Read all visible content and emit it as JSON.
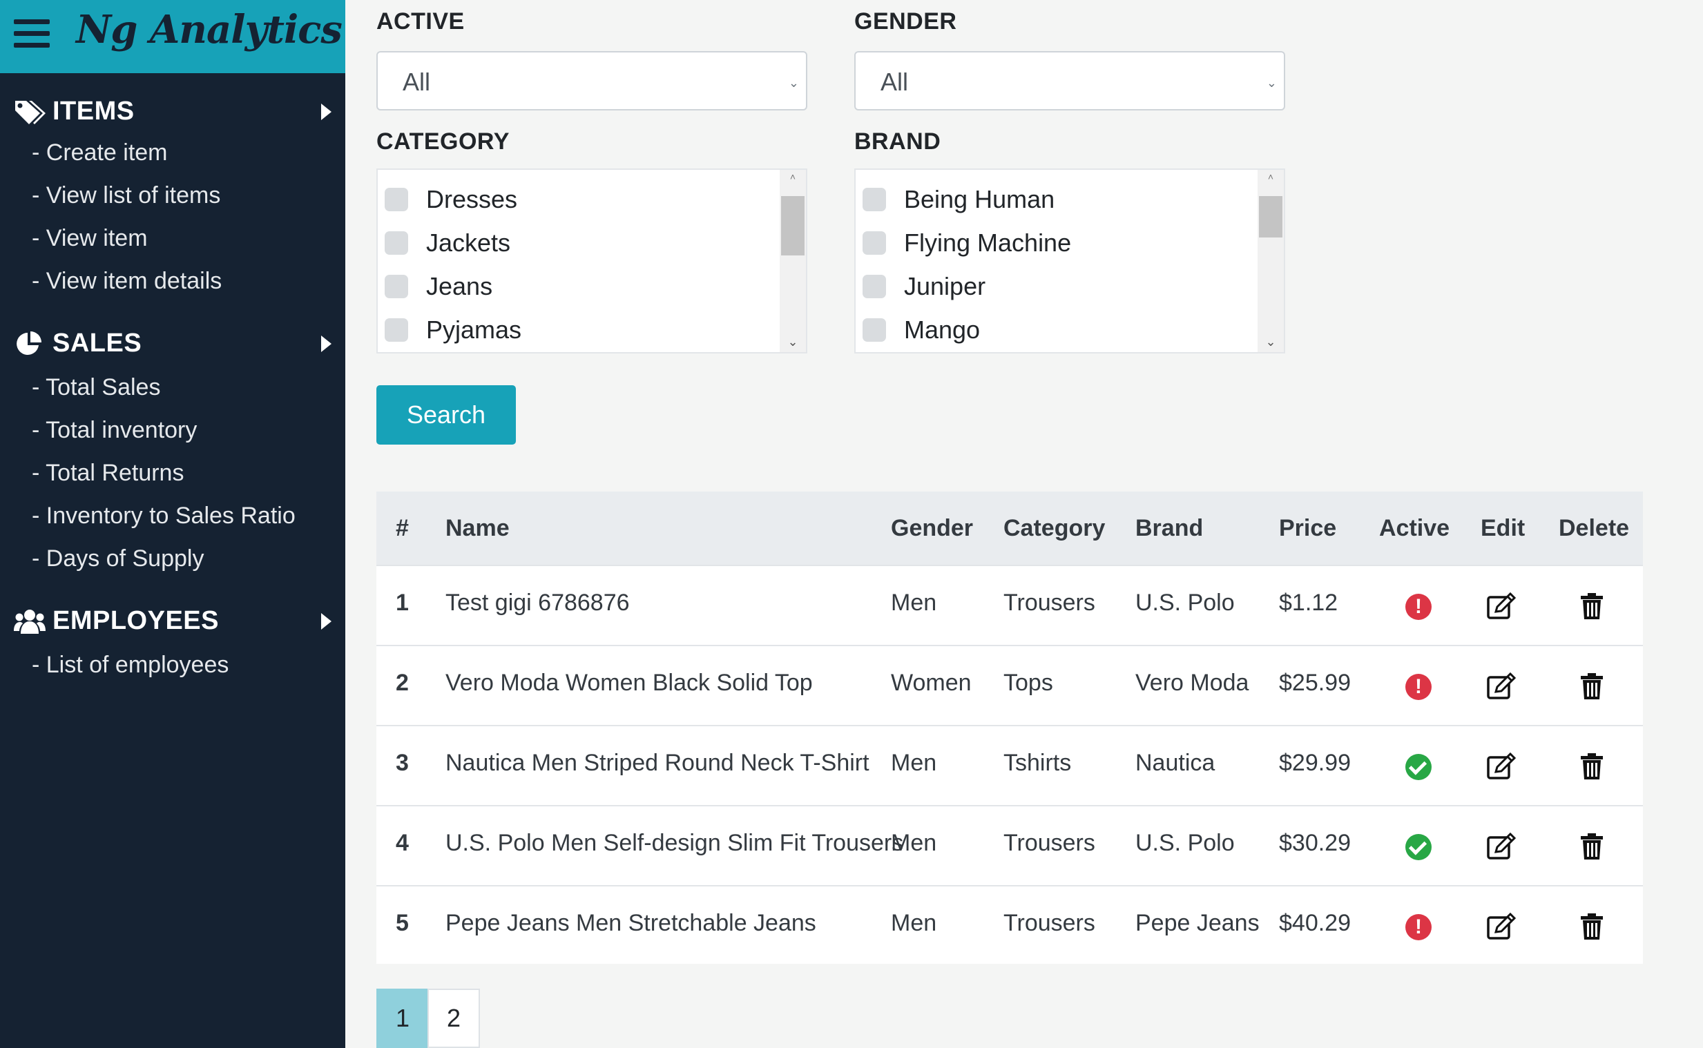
{
  "app": {
    "title": "Ng Analytics"
  },
  "sidebar": {
    "sections": [
      {
        "title": "ITEMS",
        "icon": "tags-icon",
        "links": [
          "- Create item",
          "- View list of items",
          "- View item",
          "- View item details"
        ]
      },
      {
        "title": "SALES",
        "icon": "pie-chart-icon",
        "links": [
          "- Total Sales",
          "- Total inventory",
          "- Total Returns",
          "- Inventory to Sales Ratio",
          "- Days of Supply"
        ]
      },
      {
        "title": "EMPLOYEES",
        "icon": "users-icon",
        "links": [
          "- List of employees"
        ]
      }
    ]
  },
  "filters": {
    "active": {
      "label": "ACTIVE",
      "value": "All"
    },
    "gender": {
      "label": "GENDER",
      "value": "All"
    },
    "category": {
      "label": "CATEGORY",
      "options": [
        "Dresses",
        "Jackets",
        "Jeans",
        "Pyjamas"
      ]
    },
    "brand": {
      "label": "BRAND",
      "options": [
        "Being Human",
        "Flying Machine",
        "Juniper",
        "Mango"
      ]
    },
    "search_label": "Search"
  },
  "table": {
    "headers": [
      "#",
      "Name",
      "Gender",
      "Category",
      "Brand",
      "Price",
      "Active",
      "Edit",
      "Delete"
    ],
    "rows": [
      {
        "num": "1",
        "name": "Test gigi 6786876",
        "gender": "Men",
        "category": "Trousers",
        "brand": "U.S. Polo",
        "price": "$1.12",
        "active": false
      },
      {
        "num": "2",
        "name": "Vero Moda Women Black Solid Top",
        "gender": "Women",
        "category": "Tops",
        "brand": "Vero Moda",
        "price": "$25.99",
        "active": false
      },
      {
        "num": "3",
        "name": "Nautica Men Striped Round Neck T-Shirt",
        "gender": "Men",
        "category": "Tshirts",
        "brand": "Nautica",
        "price": "$29.99",
        "active": true
      },
      {
        "num": "4",
        "name": "U.S. Polo Men Self-design Slim Fit Trousers",
        "gender": "Men",
        "category": "Trousers",
        "brand": "U.S. Polo",
        "price": "$30.29",
        "active": true
      },
      {
        "num": "5",
        "name": "Pepe Jeans Men Stretchable Jeans",
        "gender": "Men",
        "category": "Trousers",
        "brand": "Pepe Jeans",
        "price": "$40.29",
        "active": false
      }
    ]
  },
  "pagination": {
    "pages": [
      "1",
      "2"
    ],
    "current": "1"
  },
  "colors": {
    "sidebar": "#152232",
    "accent": "#17a2b8",
    "inactive": "#dc3545",
    "active": "#28a745"
  }
}
